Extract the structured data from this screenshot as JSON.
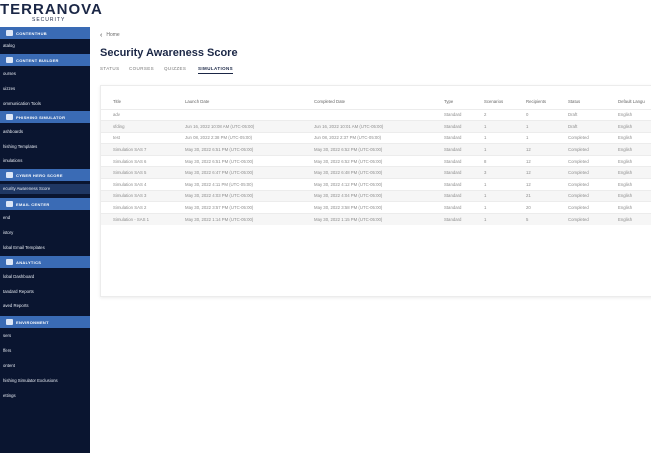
{
  "brand": {
    "name": "TERRANOVA",
    "sub": "SECURITY"
  },
  "sidebar": {
    "sections": [
      {
        "label": "CONTENTHUB",
        "items": [
          "atalog"
        ]
      },
      {
        "label": "CONTENT BUILDER",
        "items": [
          "ourses",
          "uizzes",
          "ommunication Tools"
        ]
      },
      {
        "label": "PHISHING SIMULATOR",
        "items": [
          "ashboards",
          "hishing Templates",
          "imulations"
        ]
      },
      {
        "label": "CYBER HERO SCORE",
        "items": [
          "ecurity Awareness Score"
        ]
      },
      {
        "label": "EMAIL CENTER",
        "items": [
          "end",
          "istory",
          "lobal Email Templates"
        ]
      },
      {
        "label": "ANALYTICS",
        "items": [
          "lobal Dashboard",
          "tandard Reports",
          "aved Reports"
        ]
      },
      {
        "label": "ENVIRONMENT",
        "items": [
          "sers",
          "ffers",
          "ontent",
          "hishing Simulator Exclusions",
          "ettings"
        ]
      }
    ]
  },
  "breadcrumb": {
    "label": "Home"
  },
  "page": {
    "title": "Security Awareness Score"
  },
  "tabs": [
    "STATUS",
    "COURSES",
    "QUIZZES",
    "SIMULATIONS"
  ],
  "active_tab": "SIMULATIONS",
  "table": {
    "columns": [
      "Title",
      "Launch Date",
      "Completed Date",
      "Type",
      "Scenarios",
      "Recipients",
      "Status",
      "Default Langu"
    ],
    "rows": [
      [
        "adv",
        "",
        "",
        "Standard",
        "2",
        "0",
        "Draft",
        "English"
      ],
      [
        "sfding",
        "Jun 16, 2022 10:08 AM (UTC-05:00)",
        "Jun 16, 2022 10:01 AM (UTC-05:00)",
        "Standard",
        "1",
        "1",
        "Draft",
        "English"
      ],
      [
        "test",
        "Jun 08, 2022 2:38 PM (UTC-05:00)",
        "Jun 08, 2022 2:37 PM (UTC-05:00)",
        "Standard",
        "1",
        "1",
        "Completed",
        "English"
      ],
      [
        "Simulation SAS 7",
        "May 30, 2022 6:51 PM (UTC-05:00)",
        "May 30, 2022 6:52 PM (UTC-05:00)",
        "Standard",
        "1",
        "12",
        "Completed",
        "English"
      ],
      [
        "Simulation SAS 6",
        "May 30, 2022 6:51 PM (UTC-05:00)",
        "May 30, 2022 6:52 PM (UTC-05:00)",
        "Standard",
        "8",
        "12",
        "Completed",
        "English"
      ],
      [
        "Simulation SAS 5",
        "May 30, 2022 6:47 PM (UTC-05:00)",
        "May 30, 2022 6:48 PM (UTC-05:00)",
        "Standard",
        "3",
        "12",
        "Completed",
        "English"
      ],
      [
        "Simulation SAS 4",
        "May 30, 2022 4:11 PM (UTC-05:00)",
        "May 30, 2022 4:12 PM (UTC-05:00)",
        "Standard",
        "1",
        "12",
        "Completed",
        "English"
      ],
      [
        "Simulation SAS 3",
        "May 30, 2022 4:03 PM (UTC-05:00)",
        "May 30, 2022 4:04 PM (UTC-05:00)",
        "Standard",
        "1",
        "21",
        "Completed",
        "English"
      ],
      [
        "Simulation SAS 2",
        "May 30, 2022 3:57 PM (UTC-05:00)",
        "May 30, 2022 3:58 PM (UTC-05:00)",
        "Standard",
        "1",
        "20",
        "Completed",
        "English"
      ],
      [
        "Simulation - SAS 1",
        "May 30, 2022 1:14 PM (UTC-05:00)",
        "May 30, 2022 1:15 PM (UTC-05:00)",
        "Standard",
        "1",
        "5",
        "Completed",
        "English"
      ]
    ]
  },
  "colors": {
    "sidebar_bg": "#0a1530",
    "section_bg": "#3a6bb5",
    "title": "#1b2746"
  }
}
